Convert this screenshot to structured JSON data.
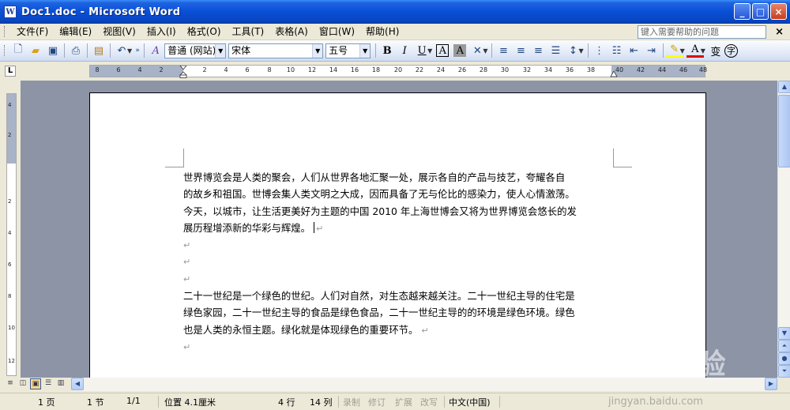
{
  "window": {
    "title": "Doc1.doc - Microsoft Word",
    "icon_letter": "W",
    "buttons": {
      "minimize": "_",
      "maximize": "□",
      "close": "×"
    }
  },
  "menubar": {
    "items": [
      "文件(F)",
      "编辑(E)",
      "视图(V)",
      "插入(I)",
      "格式(O)",
      "工具(T)",
      "表格(A)",
      "窗口(W)",
      "帮助(H)"
    ],
    "help_placeholder": "键入需要帮助的问题",
    "close": "×"
  },
  "toolbar": {
    "style_value": "普通 (网站)",
    "font_value": "宋体",
    "size_value": "五号",
    "bold": "B",
    "italic": "I",
    "underline": "U",
    "border_char": "A",
    "shade_char": "A",
    "font_color_char": "A",
    "phonetic_char": "变",
    "enclose_char": "字"
  },
  "ruler": {
    "tab_selector": "L",
    "h_numbers": [
      "8",
      "6",
      "4",
      "2",
      "2",
      "4",
      "6",
      "8",
      "10",
      "12",
      "14",
      "16",
      "18",
      "20",
      "22",
      "24",
      "26",
      "28",
      "30",
      "32",
      "34",
      "36",
      "38",
      "40",
      "42",
      "44",
      "46",
      "48"
    ],
    "v_numbers": [
      "4",
      "2",
      "2",
      "4",
      "6",
      "8",
      "10",
      "12"
    ]
  },
  "document": {
    "para1_lines": [
      "世界博览会是人类的聚会，人们从世界各地汇聚一处，展示各自的产品与技艺，夸耀各自",
      "的故乡和祖国。世博会集人类文明之大成，因而具备了无与伦比的感染力，使人心情激荡。",
      "今天，以城市，让生活更美好为主题的中国 2010 年上海世博会又将为世界博览会悠长的发",
      "展历程增添新的华彩与辉煌。"
    ],
    "para2_lines": [
      "二十一世纪是一个绿色的世纪。人们对自然，对生态越来越关注。二十一世纪主导的住宅是",
      "绿色家园，二十一世纪主导的食品是绿色食品，二十一世纪主导的的环境是绿色环境。绿色",
      "也是人类的永恒主题。绿化就是体现绿色的重要环节。"
    ],
    "para_mark": "↵"
  },
  "statusbar": {
    "page": "1 页",
    "section": "1 节",
    "page_of": "1/1",
    "position": "位置 4.1厘米",
    "line": "4 行",
    "column": "14 列",
    "rec": "录制",
    "trk": "修订",
    "ext": "扩展",
    "ovr": "改写",
    "language": "中文(中国)"
  },
  "watermark": {
    "logo": "Bai 经验",
    "url": "jingyan.baidu.com"
  }
}
